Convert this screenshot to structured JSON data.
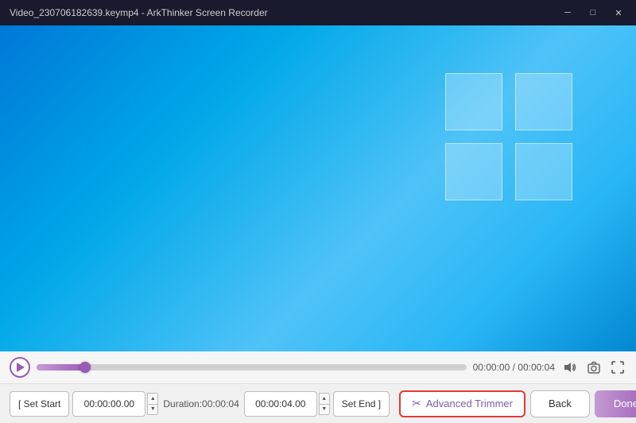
{
  "titleBar": {
    "title": "Video_230706182639.keymp4 - ArkThinker Screen Recorder",
    "minimizeLabel": "─",
    "maximizeLabel": "□",
    "closeLabel": "✕"
  },
  "timeline": {
    "currentTime": "00:00:00",
    "totalTime": "00:00:04",
    "timeDisplay": "00:00:00 / 00:00:04",
    "fillPercent": "12%"
  },
  "actions": {
    "setStartLabel": "[ Set Start",
    "startTimeValue": "00:00:00.00",
    "durationLabel": "Duration:00:00:04",
    "endTimeValue": "00:00:04.00",
    "setEndLabel": "Set End ]",
    "advancedTrimmerLabel": "Advanced Trimmer",
    "backLabel": "Back",
    "doneLabel": "Done",
    "scissorsIcon": "✂"
  }
}
